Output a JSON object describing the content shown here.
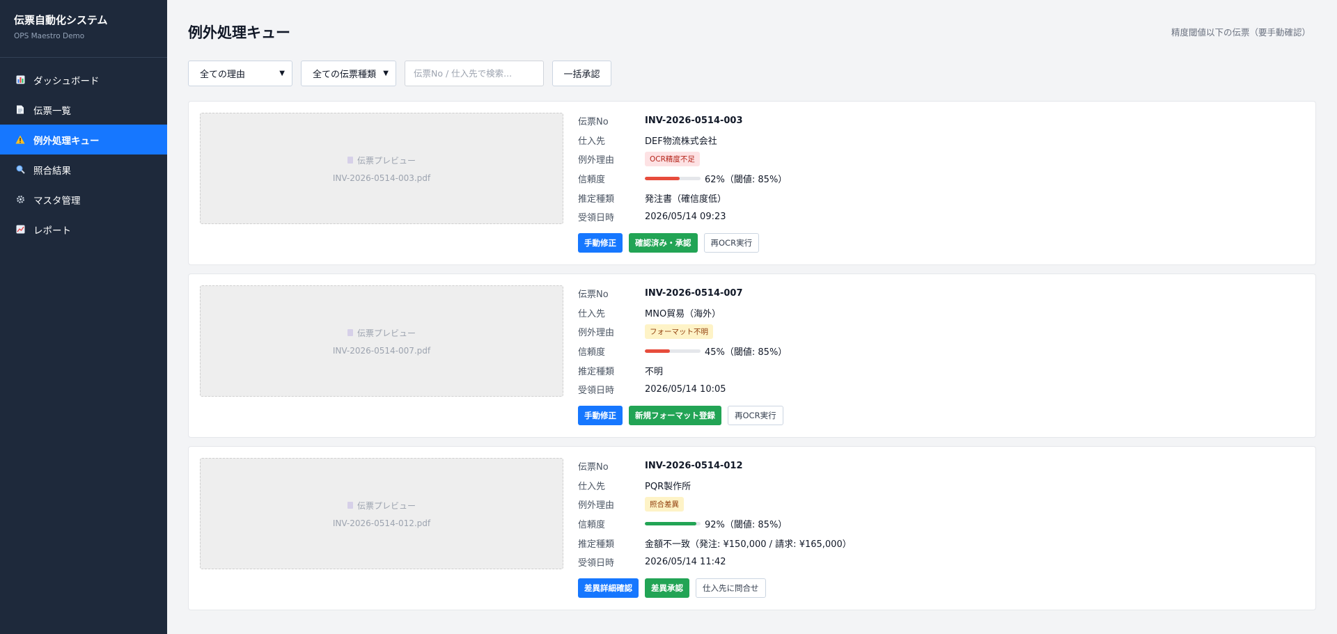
{
  "app": {
    "title": "伝票自動化システム",
    "subtitle": "OPS Maestro Demo"
  },
  "sidebar": {
    "items": [
      {
        "label": "ダッシュボード",
        "icon": "bar-chart-icon",
        "active": false
      },
      {
        "label": "伝票一覧",
        "icon": "document-icon",
        "active": false
      },
      {
        "label": "例外処理キュー",
        "icon": "warning-icon",
        "active": true
      },
      {
        "label": "照合結果",
        "icon": "magnifier-icon",
        "active": false
      },
      {
        "label": "マスタ管理",
        "icon": "gear-icon",
        "active": false
      },
      {
        "label": "レポート",
        "icon": "line-chart-icon",
        "active": false
      }
    ]
  },
  "header": {
    "title": "例外処理キュー",
    "note": "精度閾値以下の伝票（要手動確認）"
  },
  "filters": {
    "reason_selected": "全ての理由",
    "type_selected": "全ての伝票種類",
    "search_placeholder": "伝票No / 仕入先で検索...",
    "bulk_approve": "一括承認"
  },
  "labels": {
    "invoice_no": "伝票No",
    "supplier": "仕入先",
    "reason": "例外理由",
    "confidence": "信頼度",
    "estimated_type": "推定種類",
    "received_at": "受領日時",
    "preview": "伝票プレビュー"
  },
  "colors": {
    "accent": "#1677ff",
    "success": "#22a455",
    "danger": "#e74c3c",
    "sidebar_bg": "#1e293b"
  },
  "cards": [
    {
      "file": "INV-2026-0514-003.pdf",
      "invoice_no": "INV-2026-0514-003",
      "supplier": "DEF物流株式会社",
      "reason": "OCR精度不足",
      "reason_style": "red",
      "confidence_pct": 62,
      "confidence_text": "62%（閾値: 85%）",
      "estimated_type": "発注書（確信度低）",
      "received_at": "2026/05/14 09:23",
      "actions": [
        "手動修正",
        "確認済み・承認",
        "再OCR実行"
      ]
    },
    {
      "file": "INV-2026-0514-007.pdf",
      "invoice_no": "INV-2026-0514-007",
      "supplier": "MNO貿易（海外）",
      "reason": "フォーマット不明",
      "reason_style": "yellow",
      "confidence_pct": 45,
      "confidence_text": "45%（閾値: 85%）",
      "estimated_type": "不明",
      "received_at": "2026/05/14 10:05",
      "actions": [
        "手動修正",
        "新規フォーマット登録",
        "再OCR実行"
      ]
    },
    {
      "file": "INV-2026-0514-012.pdf",
      "invoice_no": "INV-2026-0514-012",
      "supplier": "PQR製作所",
      "reason": "照合差異",
      "reason_style": "yellow",
      "confidence_pct": 92,
      "confidence_text": "92%（閾値: 85%）",
      "estimated_type": "金額不一致（発注: ¥150,000 / 請求: ¥165,000）",
      "received_at": "2026/05/14 11:42",
      "actions": [
        "差異詳細確認",
        "差異承認",
        "仕入先に問合せ"
      ]
    }
  ]
}
